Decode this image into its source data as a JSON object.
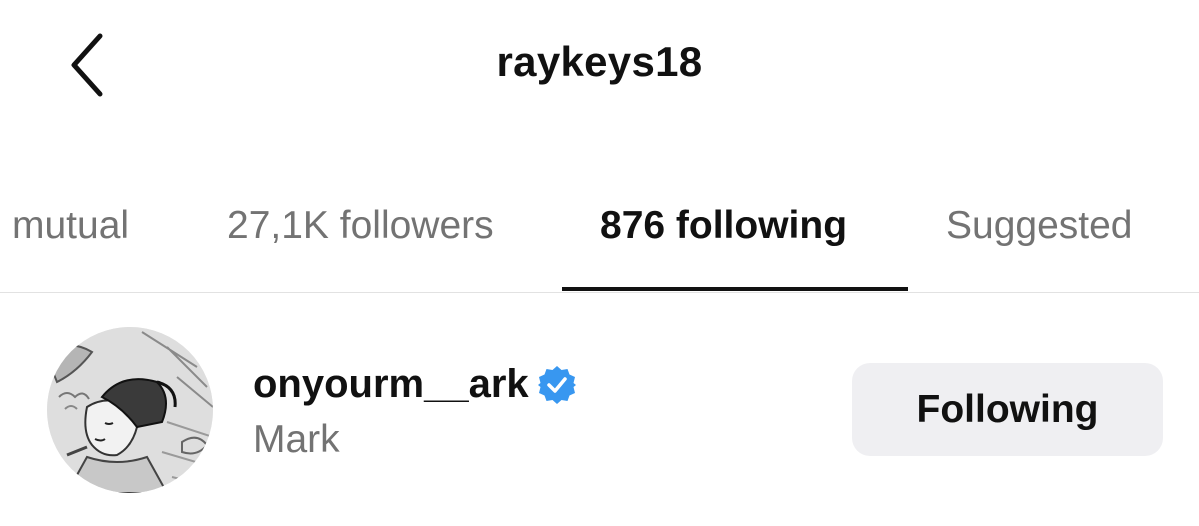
{
  "header": {
    "title": "raykeys18",
    "back_icon": "chevron-left-icon"
  },
  "tabs": [
    {
      "label": "mutual",
      "active": false
    },
    {
      "label": "27,1K followers",
      "active": false
    },
    {
      "label": "876 following",
      "active": true
    },
    {
      "label": "Suggested",
      "active": false
    }
  ],
  "user": {
    "username": "onyourm__ark",
    "verified": true,
    "verified_icon": "verified-badge-icon",
    "display_name": "Mark",
    "avatar_icon": "avatar-sketch",
    "button_label": "Following"
  },
  "colors": {
    "text_primary": "#111111",
    "text_secondary": "#737373",
    "verified_blue": "#3897f0",
    "button_bg": "#efeff2",
    "divider": "#e2e2e2"
  }
}
